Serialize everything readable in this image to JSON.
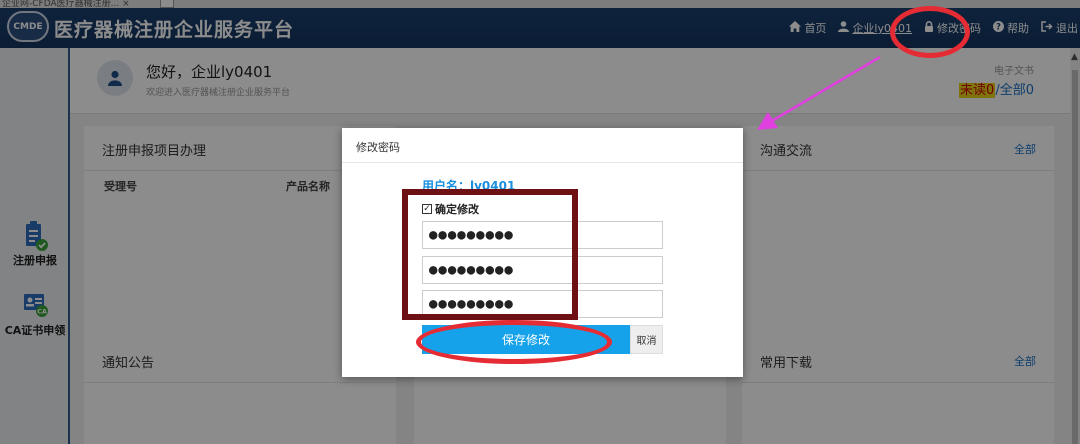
{
  "browser": {
    "tab_title": "企业网-CFDA医疗器械注册...",
    "close_glyph": "×"
  },
  "header": {
    "logo_text": "CMDE",
    "title": "医疗器械注册企业服务平台",
    "nav": {
      "home": "首页",
      "user": "企业ly0401",
      "change_password": "修改密码",
      "help": "帮助",
      "logout": "退出"
    }
  },
  "sidebar": {
    "items": [
      {
        "label": "注册申报",
        "icon": "clipboard-check-icon"
      },
      {
        "label": "CA证书申领",
        "icon": "ca-certificate-icon"
      }
    ]
  },
  "welcome": {
    "greeting": "您好，企业ly0401",
    "subtitle": "欢迎进入医疗器械注册企业服务平台",
    "doc_label": "电子文书",
    "unread_label": "未读",
    "unread_count": "0",
    "separator": "/",
    "all_label": "全部",
    "all_count": "0"
  },
  "panels": {
    "registration": {
      "title": "注册申报项目办理",
      "col1": "受理号",
      "col2": "产品名称"
    },
    "communication": {
      "title": "沟通交流",
      "all": "全部"
    },
    "notice": {
      "title": "通知公告"
    },
    "downloads": {
      "title": "常用下载",
      "all": "全部"
    }
  },
  "modal": {
    "title": "修改密码",
    "username": "用户名：ly0401",
    "confirm_label": "确定修改",
    "confirm_checked": true,
    "check_glyph": "✓",
    "password_mask": "●●●●●●●●●",
    "save_label": "保存修改",
    "cancel_label": "取消"
  },
  "colors": {
    "header_bg": "#1a3f6e",
    "accent_blue": "#15a2ea",
    "annotation_red": "#e52c34",
    "annotation_dark_red": "#6e1114",
    "annotation_magenta": "#e040e0"
  }
}
